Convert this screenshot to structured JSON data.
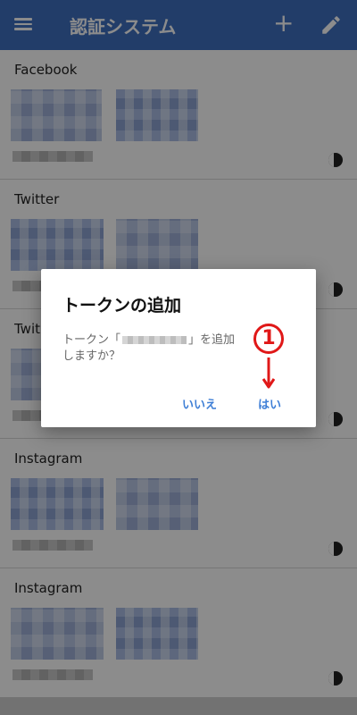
{
  "app_bar": {
    "title": "認証システム",
    "menu_icon": "menu-icon",
    "add_icon": "plus-icon",
    "add_label": "+",
    "edit_icon": "pencil-icon",
    "color": "#3f6fbf"
  },
  "accounts": [
    {
      "name": "Facebook"
    },
    {
      "name": "Twitter"
    },
    {
      "name": "Twit"
    },
    {
      "name": "Instagram"
    },
    {
      "name": "Instagram"
    }
  ],
  "dialog": {
    "title": "トークンの追加",
    "message_before": "トークン「",
    "message_after": "」を追加しますか？",
    "no_label": "いいえ",
    "yes_label": "はい",
    "button_color": "#3f7fd6"
  },
  "annotation": {
    "step_label": "1",
    "color": "#e01818"
  }
}
